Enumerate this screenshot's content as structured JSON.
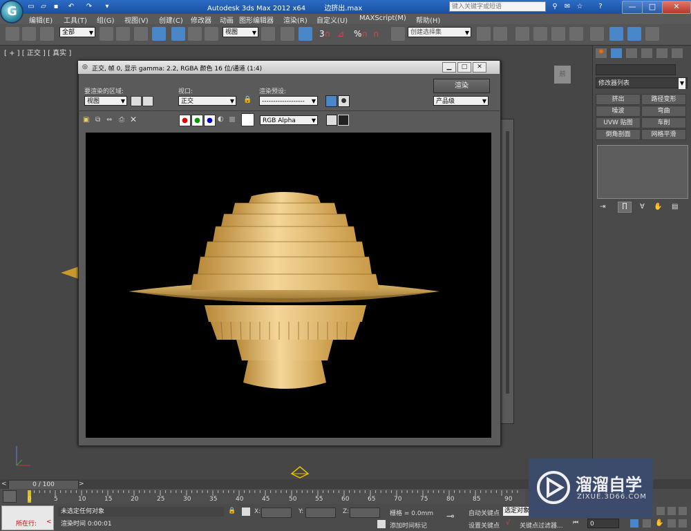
{
  "titlebar": {
    "title": "Autodesk 3ds Max  2012 x64",
    "file": "边挤出.max",
    "search_placeholder": "键入关键字或短语",
    "minimize": "—",
    "maximize": "□",
    "close": "✕"
  },
  "menu": [
    "编辑(E)",
    "工具(T)",
    "组(G)",
    "视图(V)",
    "创建(C)",
    "修改器",
    "动画",
    "图形编辑器",
    "渲染(R)",
    "自定义(U)",
    "MAXScript(M)",
    "帮助(H)"
  ],
  "toolbar": {
    "selection_filter": "全部",
    "ref_coord": "视图",
    "named_selection": "创建选择集",
    "angle_snap": "3",
    "percent_snap": "%"
  },
  "viewport": {
    "label_plus": "[ + ]",
    "label_view": "[ 正交 ]",
    "label_shading": "[ 真实 ]",
    "viewcube": "前"
  },
  "command_panel": {
    "modifier_list": "修改器列表",
    "modifiers": [
      "挤出",
      "路径变形",
      "噪波",
      "弯曲",
      "UVW 贴图",
      "车削",
      "倒角剖面",
      "网格平滑"
    ]
  },
  "render_window": {
    "title": "正交, 帧 0, 显示 gamma: 2.2, RGBA 颜色 16 位/通道 (1:4)",
    "area_label": "要渲染的区域:",
    "area_value": "视图",
    "viewport_label": "视口:",
    "viewport_value": "正交",
    "preset_label": "渲染预设:",
    "preset_value": "-------------------",
    "render_button": "渲染",
    "quality_value": "产品级",
    "channel_value": "RGB Alpha"
  },
  "bottom": {
    "frame_counter": "0 / 100",
    "ruler_ticks": [
      "0",
      "5",
      "10",
      "15",
      "20",
      "25",
      "30",
      "35",
      "40",
      "45",
      "50",
      "55",
      "60",
      "65",
      "70",
      "75",
      "80",
      "85",
      "90"
    ],
    "status_left": "所在行:",
    "status_message": "未选定任何对象",
    "render_time": "渲染时间  0:00:01",
    "x_label": "X:",
    "y_label": "Y:",
    "z_label": "Z:",
    "grid": "栅格 = 0.0mm",
    "add_time_tag": "添加时间标记",
    "auto_key": "自动关键点",
    "selected_obj": "选定对象",
    "set_key": "设置关键点",
    "key_filter": "关键点过滤器...",
    "frame_value": "0"
  },
  "watermark": {
    "name": "溜溜自学",
    "url": "ZIXUE.3D66.COM"
  },
  "colors": {
    "title_blue": "#1a4fa0",
    "object_gold": "#d9b565",
    "viewport_bg": "#464646"
  }
}
